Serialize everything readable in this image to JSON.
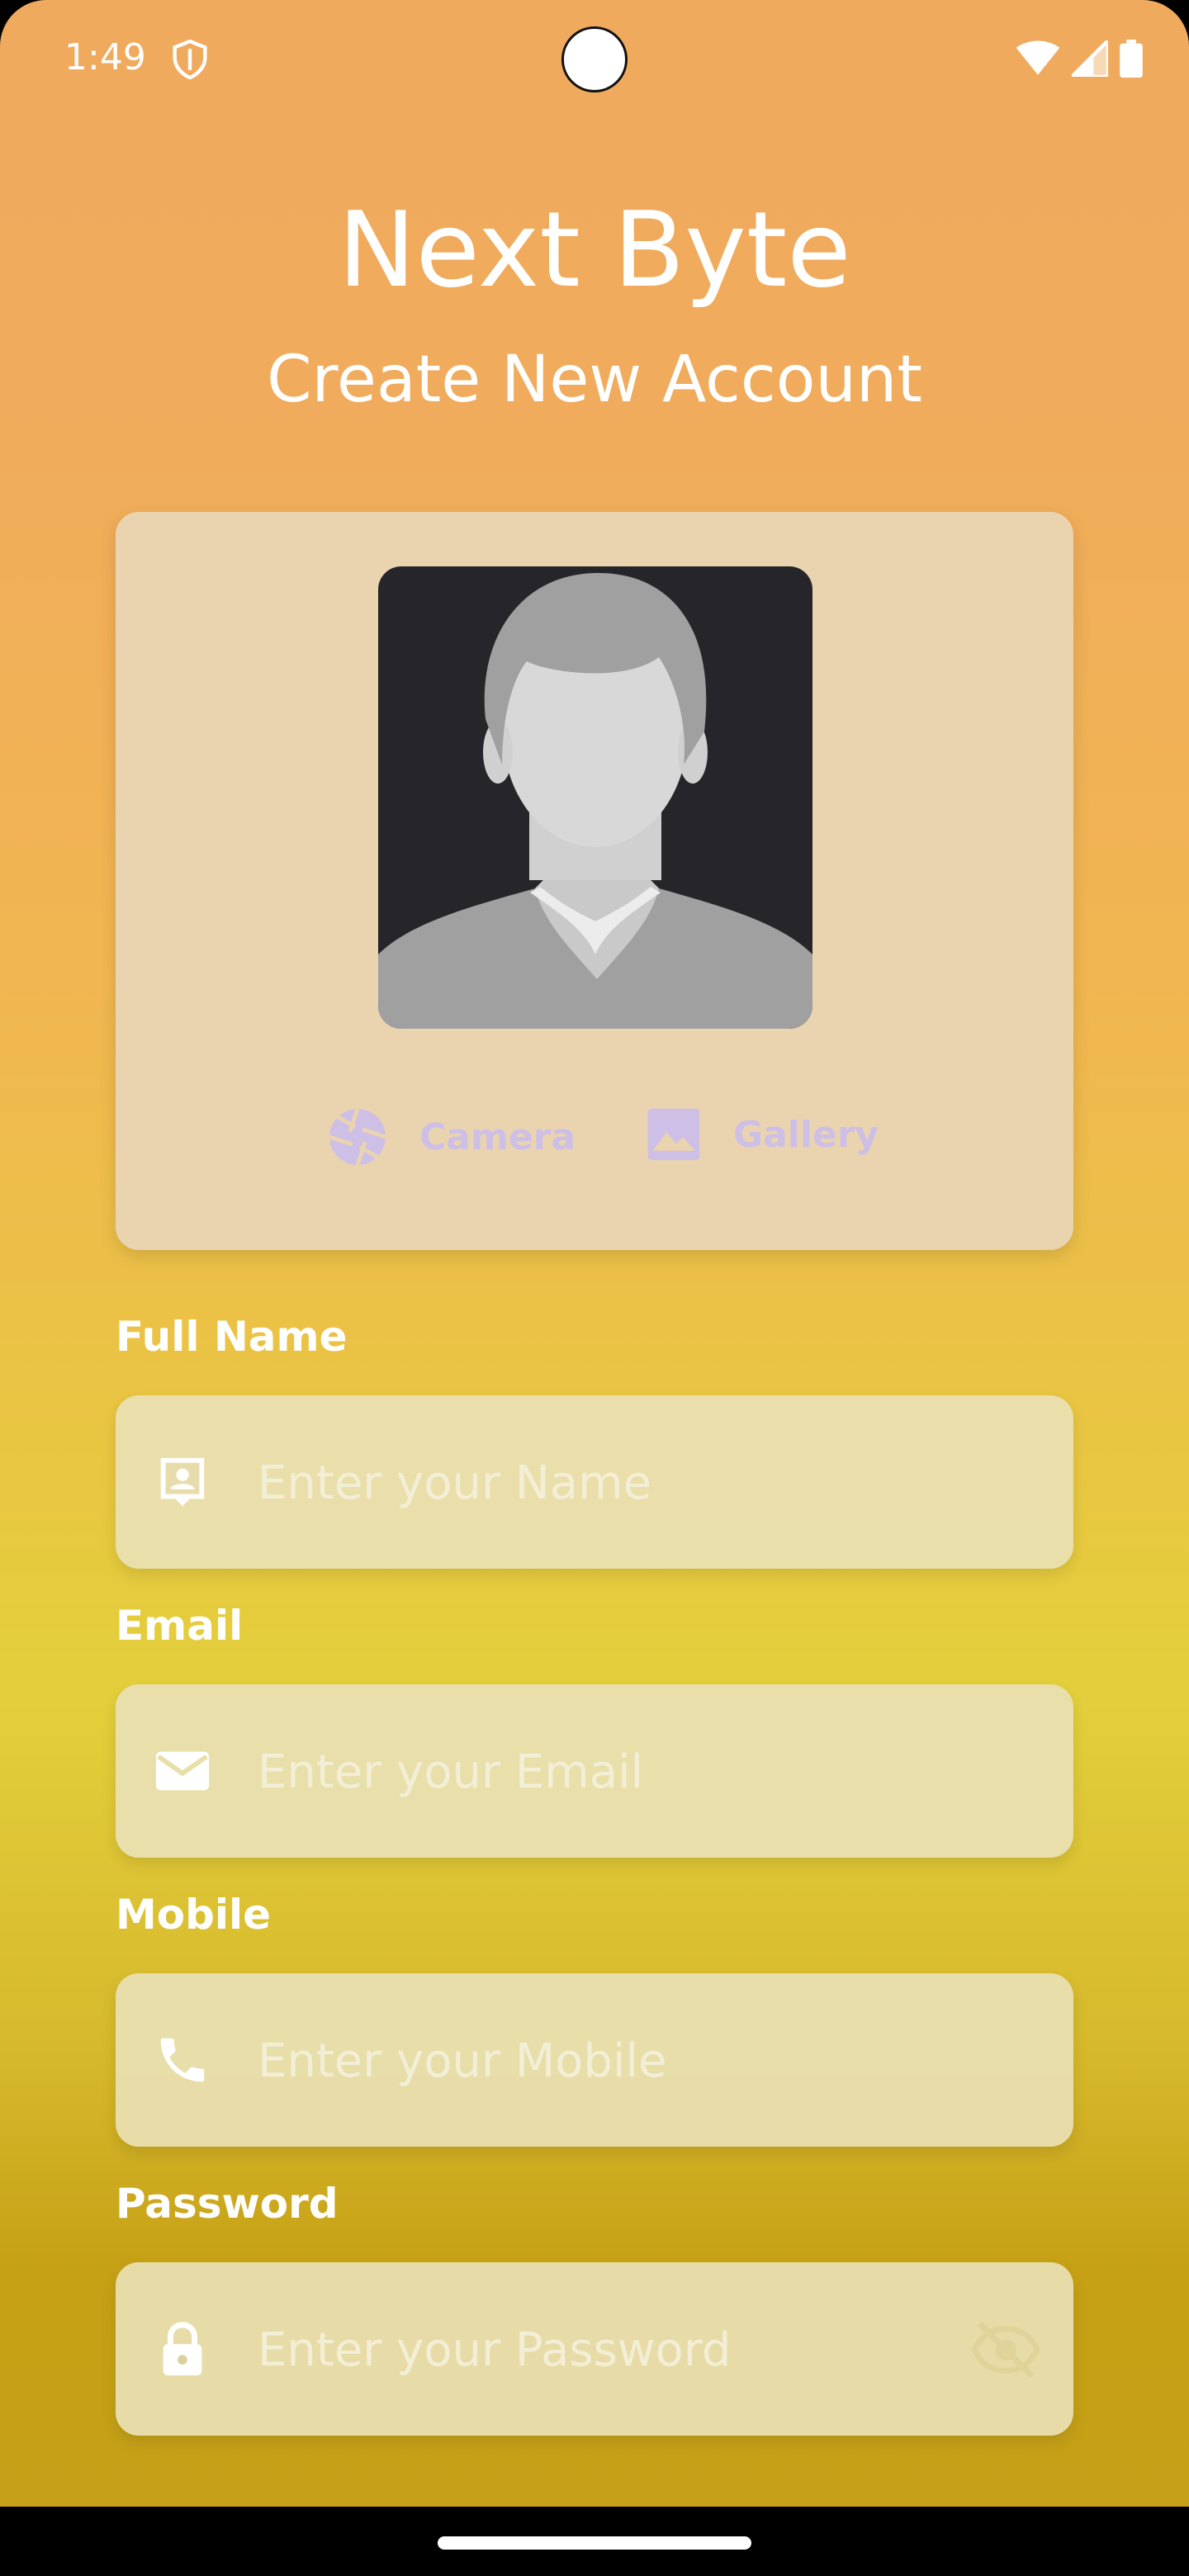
{
  "status_bar": {
    "time": "1:49",
    "icons": [
      "shield-icon",
      "wifi-icon",
      "signal-icon",
      "battery-icon"
    ]
  },
  "header": {
    "title": "Next Byte",
    "subtitle": "Create New Account"
  },
  "photo_picker": {
    "camera_label": "Camera",
    "gallery_label": "Gallery",
    "accent": "#cdbfe6"
  },
  "form": {
    "full_name": {
      "label": "Full Name",
      "placeholder": "Enter your Name",
      "icon": "contact-card-icon"
    },
    "email": {
      "label": "Email",
      "placeholder": "Enter your Email",
      "icon": "mail-icon"
    },
    "mobile": {
      "label": "Mobile",
      "placeholder": "Enter your Mobile",
      "icon": "phone-icon"
    },
    "password": {
      "label": "Password",
      "placeholder": "Enter your Password",
      "icon": "lock-icon",
      "toggle_icon": "eye-off-icon"
    }
  },
  "colors": {
    "gradient_top": "#f0aa5e",
    "gradient_mid": "#e3cf3b",
    "gradient_bottom": "#c5a018",
    "text": "#ffffff"
  }
}
